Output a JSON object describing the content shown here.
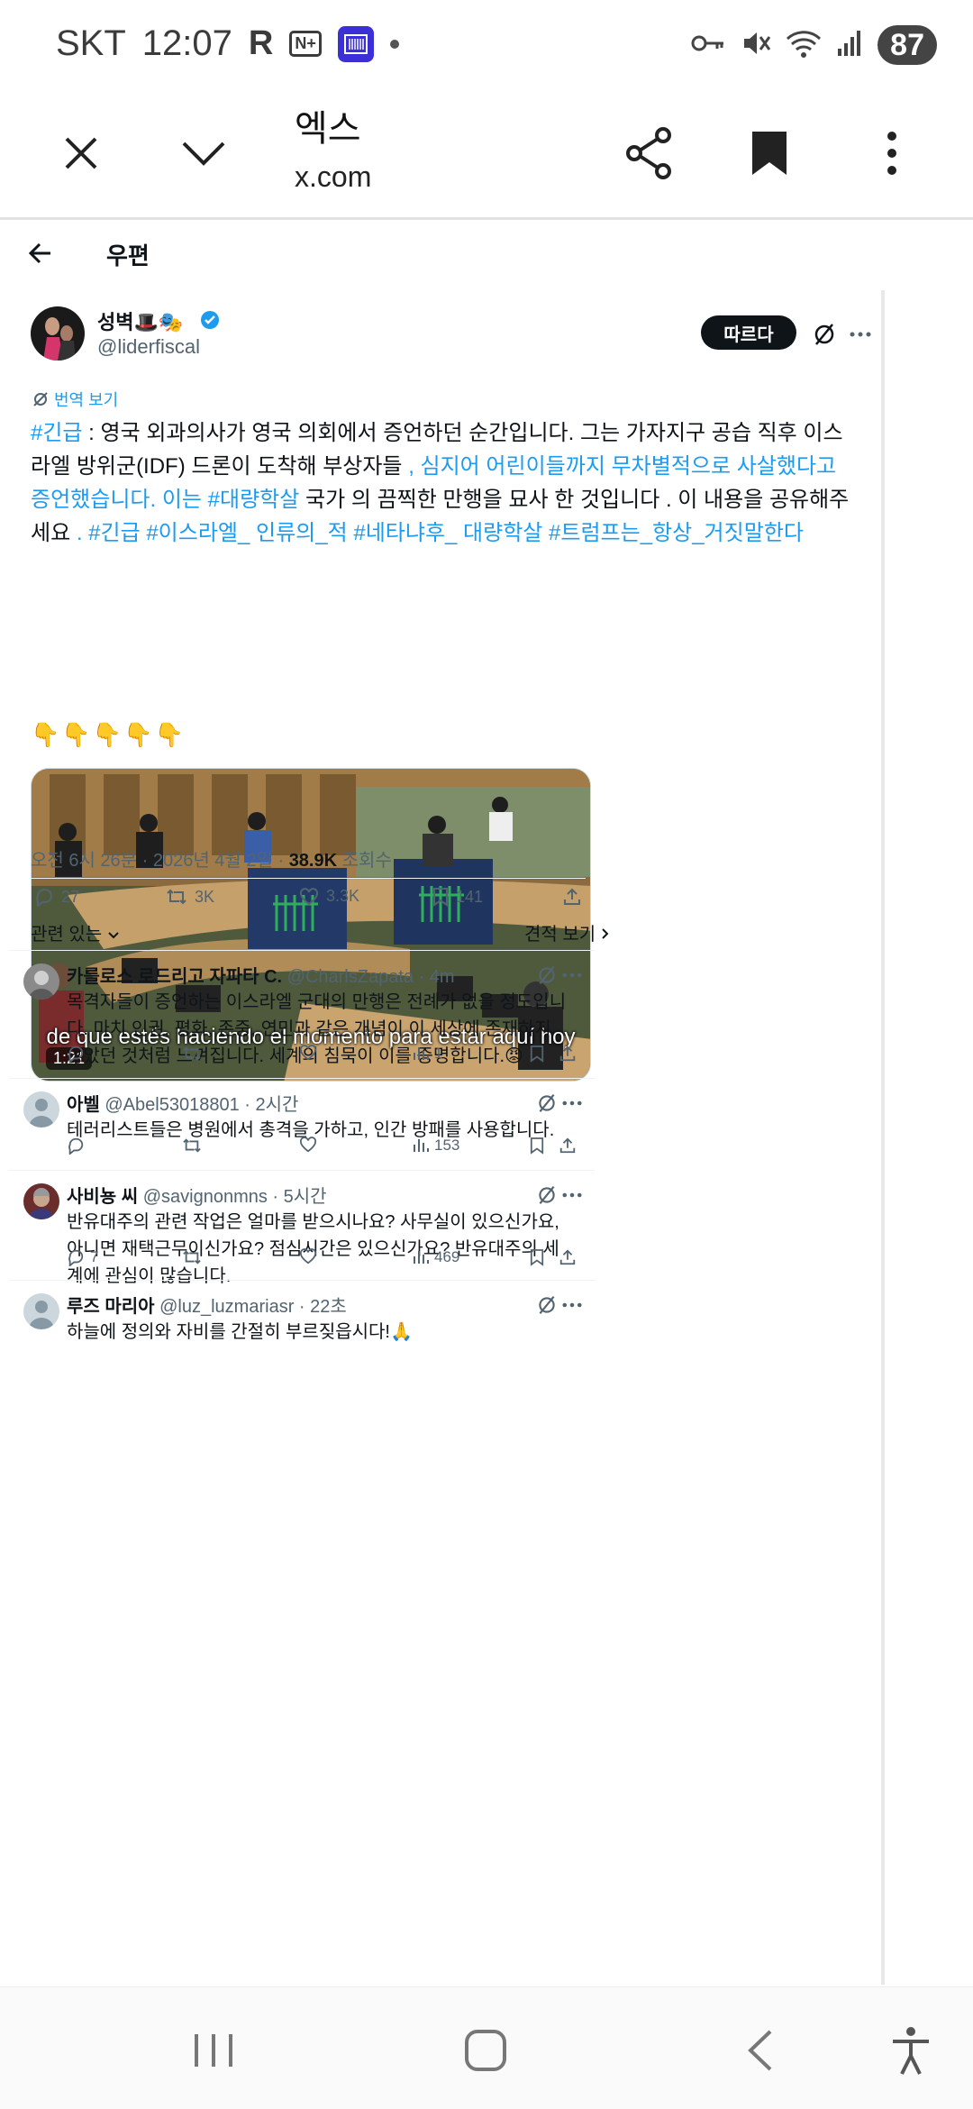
{
  "status_bar": {
    "carrier": "SKT",
    "time": "12:07",
    "r_indicator": "R",
    "n_box": "N+",
    "battery": "87"
  },
  "browser": {
    "title": "엑스",
    "url": "x.com"
  },
  "page": {
    "title": "우편"
  },
  "tweet": {
    "author_name": "성벽🎩🎭",
    "author_handle": "@liderfiscal",
    "follow_label": "따르다",
    "translate_label": "번역 보기",
    "text_parts": [
      {
        "text": "#긴급",
        "link": true
      },
      {
        "text": " : 영국 외과의사가 영국 의회에서 증언하던 순간입니다. 그는 가자지구 공습 직후 이스라엘 방위군(IDF) 드론이 도착해 부상자들 ",
        "link": false
      },
      {
        "text": ", 심지어 어린이들까지 무차별적으로 사살했다고 증언했습니다. 이는 ",
        "link": true
      },
      {
        "text": "#대량학살",
        "link": true
      },
      {
        "text": " 국가 의 끔찍한 만행을 묘사 한 것입니다 . 이 내용을 공유해주세요 ",
        "link": false
      },
      {
        "text": ". #긴급 #이스라엘_ 인류의_적 #네타냐후_ 대량학살 #트럼프는_항상_거짓말한다",
        "link": true
      }
    ],
    "emoji_line": "👇👇👇👇👇",
    "video": {
      "subtitle": "de que estés haciendo el momento para estar aquí hoy",
      "duration": "1:21"
    },
    "meta": {
      "time_date": "오전 6시 26분 · 2026년 4월 2일 · ",
      "views": "38.9K",
      "views_label": " 조회수"
    },
    "actions": {
      "replies": "27",
      "reposts": "3K",
      "likes": "3.3K",
      "bookmarks": "141"
    },
    "related_label": "관련 있는",
    "quotes_label": "견적 보기"
  },
  "replies": [
    {
      "name": "카를로스 로드리고 자파타 C.",
      "handle": "@CharlsZapata · 4m",
      "text": "목격자들이 증언하는 이스라엘 군대의 만행은 전례가 없을 정도입니다. 마치 인권, 평화, 존중, 연민과 같은 개념이 이 세상에 존재하지 않았던 것처럼 느껴집니다. 세계의 침묵이 이를 증명합니다.😡",
      "replies": "",
      "views": "1"
    },
    {
      "name": "아벨",
      "handle": "@Abel53018801 · 2시간",
      "text": "테러리스트들은 병원에서 총격을 가하고, 인간 방패를 사용합니다.",
      "replies": "",
      "views": "153"
    },
    {
      "name": "사비뇽 씨",
      "handle": "@savignonmns · 5시간",
      "text": "반유대주의 관련 작업은 얼마를 받으시나요? 사무실이 있으신가요, 아니면 재택근무이신가요? 점심시간은 있으신가요? 반유대주의 세계에 관심이 많습니다.",
      "replies": "7",
      "views": "469"
    },
    {
      "name": "루즈 마리아",
      "handle": "@luz_luzmariasr · 22초",
      "text": "하늘에 정의와 자비를 간절히 부르짖읍시다!🙏",
      "replies": "",
      "views": ""
    }
  ],
  "colors": {
    "accent": "#1d9bf0",
    "text": "#0f1419",
    "muted": "#536471"
  }
}
